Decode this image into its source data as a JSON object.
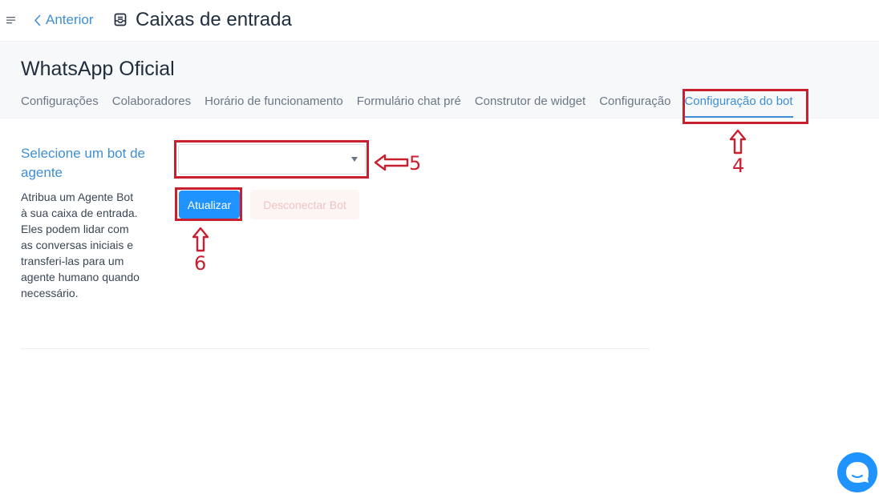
{
  "header": {
    "back_label": "Anterior",
    "title": "Caixas de entrada"
  },
  "inbox": {
    "name": "WhatsApp Oficial",
    "tabs": [
      {
        "label": "Configurações"
      },
      {
        "label": "Colaboradores"
      },
      {
        "label": "Horário de funcionamento"
      },
      {
        "label": "Formulário chat pré"
      },
      {
        "label": "Construtor de widget"
      },
      {
        "label": "Configuração"
      },
      {
        "label": "Configuração do bot",
        "active": true
      }
    ]
  },
  "bot_settings": {
    "title": "Selecione um bot de agente",
    "description": "Atribua um Agente Bot à sua caixa de entrada. Eles podem lidar com as conversas iniciais e transferi-las para um agente humano quando necessário.",
    "select_value": "",
    "update_label": "Atualizar",
    "disconnect_label": "Desconectar Bot"
  },
  "annotations": {
    "n4": "4",
    "n5": "5",
    "n6": "6",
    "color": "#c8202f"
  },
  "icons": {
    "menu": "menu-icon",
    "back": "chevron-left-icon",
    "inbox": "inbox-icon",
    "chat": "chat-bubble-icon"
  },
  "colors": {
    "accent": "#1f93ff",
    "link": "#3e8fd6"
  }
}
